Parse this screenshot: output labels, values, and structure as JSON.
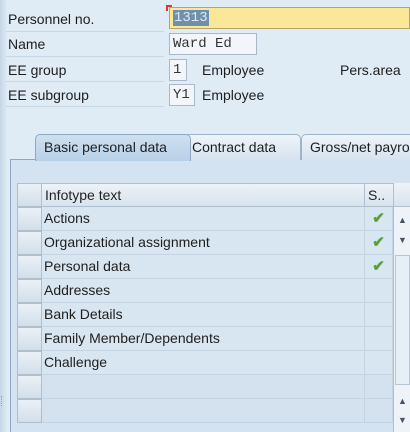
{
  "header": {
    "personnel_label": "Personnel no.",
    "personnel_value": "1313",
    "name_label": "Name",
    "name_value": "Ward Ed",
    "ee_group_label": "EE group",
    "ee_group_code": "1",
    "ee_group_text": "Employee",
    "pers_area_label": "Pers.area",
    "ee_subgroup_label": "EE subgroup",
    "ee_subgroup_code": "Y1",
    "ee_subgroup_text": "Employee"
  },
  "tabs": [
    {
      "label": "Basic personal data",
      "active": true
    },
    {
      "label": "Contract data",
      "active": false
    },
    {
      "label": "Gross/net payro",
      "active": false
    }
  ],
  "table": {
    "col_infotype": "Infotype text",
    "col_status": "S..",
    "rows": [
      {
        "text": "Actions",
        "status": "check"
      },
      {
        "text": "Organizational assignment",
        "status": "check"
      },
      {
        "text": "Personal data",
        "status": "check"
      },
      {
        "text": "Addresses",
        "status": ""
      },
      {
        "text": "Bank Details",
        "status": ""
      },
      {
        "text": "Family Member/Dependents",
        "status": ""
      },
      {
        "text": "Challenge",
        "status": ""
      }
    ],
    "check_symbol": "✔"
  },
  "colors": {
    "accent_field": "#fbe79a",
    "check_green": "#5aa03a",
    "background": "#dfebf5"
  }
}
